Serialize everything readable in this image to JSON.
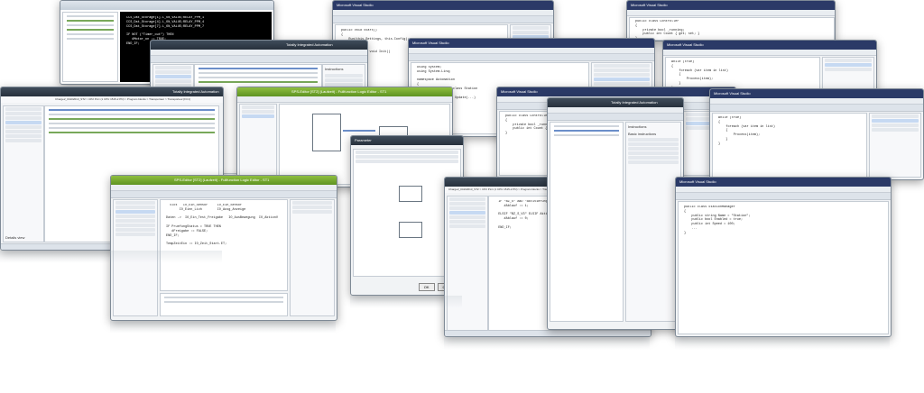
{
  "windows": {
    "siemens_left": {
      "title": "Totally Integrated Automation",
      "subtitle": "PORTAL",
      "project": "Charge2_04102013_ST2 > CP2 PLC (1 CPU 1515-2 PN) > Program blocks > Transporteur > Transporteur [FC1]",
      "panel_title": "Details view"
    },
    "siemens_center": {
      "title": "Totally Integrated Automation",
      "subtitle": "PORTAL",
      "panel_title": "Instructions",
      "section_basic": "Basic instructions",
      "section_extended": "Extended instructions"
    },
    "green_editor": {
      "title": "SPS-Editor [ST2] (Laufzeit) - Fullfunction Logic Editor - ST1"
    },
    "green_editor_2": {
      "title": "SPS-Editor [ST2] (Laufzeit) - Fullfunction Logic Editor - ST1"
    },
    "siemens_mid": {
      "title": "Totally Integrated Automation",
      "subtitle": "PORTAL",
      "project": "Charge2_04102013_ST2 > CP2 PLC (1 CPU 1515-2 PN) > Program blocks > Transporteur > Transporteur [FC1]",
      "panel_title": "Details view"
    },
    "siemens_right": {
      "title": "Totally Integrated Automation",
      "subtitle": "PORTAL",
      "panel_title": "Instructions",
      "section_basic": "Basic instructions",
      "section_extended": "Extended instructions"
    },
    "dialog": {
      "title": "Parameter",
      "ok": "OK",
      "cancel": "Cancel"
    },
    "vs_code_1": {
      "title": "Microsoft Visual Studio"
    },
    "vs_code_2": {
      "title": "Microsoft Visual Studio"
    },
    "vs_code_3": {
      "title": "Microsoft Visual Studio"
    },
    "vs_code_4": {
      "title": "Microsoft Visual Studio"
    },
    "vs_code_5": {
      "title": "Microsoft Visual Studio"
    }
  },
  "code": {
    "terminal": "CCS_Dat_Storage[1].L_ON_VALUE;RELAY_PPM_1\nCCS_Dat_Storage[4].L_ON_VALUE;RELAY_PPM_4\nCCS_Dat_Storage[7].L_ON_VALUE;RELAY_PPM_7\n\nIF NOT (\"Timer_out\") THEN\n   #Motor_on := TRUE;\nEND_IF;",
    "green_editor": "  Slot   IO_Ein_Sensor     IO_Ein_Sensor\n       IO_Einn_Lich        IO_Ausg_Anzeige\n\nDaten ->  IO_Ein_Test_Freigabe   IO_AusBewegung  IO_AktionV\n\nIF PruefungStatus = TRUE THEN\n   #Freigabe := FALSE;\nEND_IF;\n\nTempZeitEin := IO_Zeit_Start.ET;",
    "siemens_mid": "  IF \"BZ_S\" AND \"Aktivierung\" AND \"Gestartet\" THEN\n     #Ablauf := 1;\n\n  ELSIF \"BZ_S_V3\" ELSIF Aktiv THEN\n     #Ablauf := 0;\n\n  END_IF;",
    "vs_1": "public void Start()\n{\n    Run(this.Settings, this.Config);\n}\n\nprivate static void Init()\n{\n    ....\n}",
    "vs_2": "public class Controller\n{\n    private bool _running;\n    public int Count { get; set; }\n}",
    "vs_3": "using System;\nusing System.Linq;\n\nnamespace Automation\n{\n    public partial class Station\n    {\n        public void Update(...)",
    "vs_4": "while (true)\n{\n    foreach (var item in list)\n    {\n        Process(item);\n    }\n}",
    "vs_5": "public class StationManager\n{\n    public string Name = \"Station\";\n    public bool Enabled = true;\n    public int Speed = 100;\n    ...\n}"
  },
  "colors": {
    "siemens_title": "#27313c",
    "green_title": "#6fa22c",
    "vs_title": "#2b3a67",
    "status_blue": "#2b5797"
  }
}
